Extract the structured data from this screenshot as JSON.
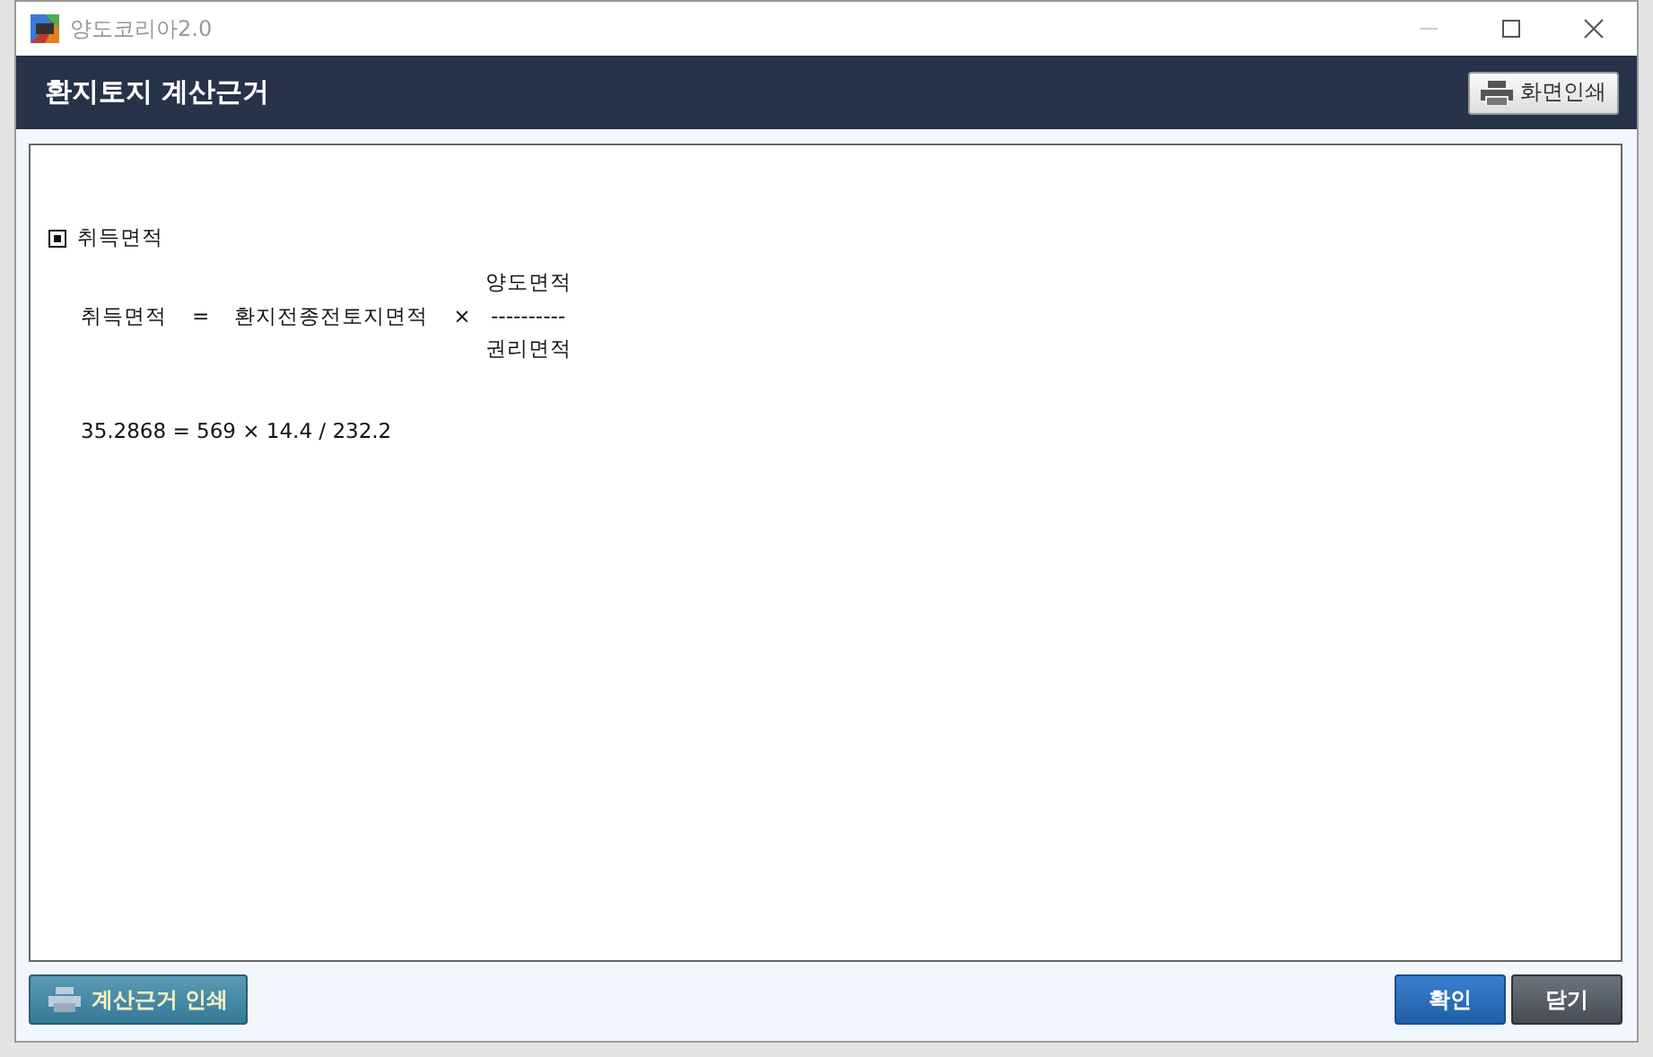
{
  "window": {
    "title": "양도코리아2.0"
  },
  "header": {
    "title": "환지토지 계산근거",
    "print_button": "화면인쇄"
  },
  "section": {
    "title": "취득면적"
  },
  "formula": {
    "lhs": "취득면적",
    "equals": "=",
    "term": "환지전종전토지면적",
    "times": "×",
    "numerator": "양도면적",
    "bar": "----------",
    "denominator": "권리면적"
  },
  "calculation": "35.2868 = 569 × 14.4 / 232.2",
  "footer": {
    "print_button": "계산근거 인쇄",
    "buttons": [
      {
        "label": "확인",
        "kind": "primary"
      },
      {
        "label": "닫기",
        "kind": "secondary"
      }
    ]
  }
}
